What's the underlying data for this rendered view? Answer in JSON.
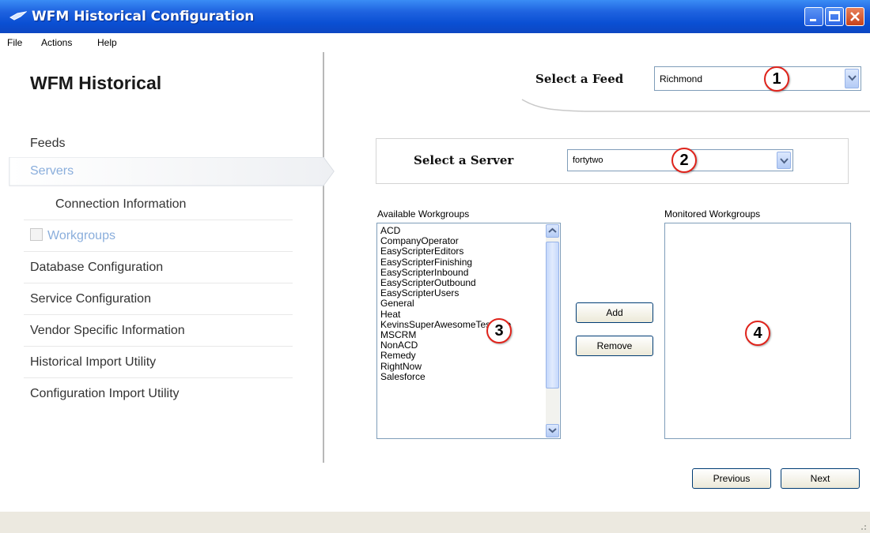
{
  "window": {
    "title": "WFM Historical Configuration"
  },
  "menubar": {
    "items": [
      "File",
      "Actions",
      "Help"
    ]
  },
  "left_panel": {
    "heading": "WFM Historical",
    "nav": [
      {
        "label": "Feeds"
      },
      {
        "label": "Servers",
        "selected": true
      },
      {
        "label": "Connection Information"
      },
      {
        "label": "Workgroups",
        "checkbox": true
      },
      {
        "label": "Database Configuration"
      },
      {
        "label": "Service Configuration"
      },
      {
        "label": "Vendor Specific Information"
      },
      {
        "label": "Historical Import Utility"
      },
      {
        "label": "Configuration Import Utility"
      }
    ]
  },
  "feed": {
    "label": "Select a Feed",
    "value": "Richmond"
  },
  "server": {
    "label": "Select a Server",
    "value": "fortytwo"
  },
  "available": {
    "label": "Available Workgroups",
    "items": [
      "ACD",
      "CompanyOperator",
      "EasyScripterEditors",
      "EasyScripterFinishing",
      "EasyScripterInbound",
      "EasyScripterOutbound",
      "EasyScripterUsers",
      "General",
      "Heat",
      "KevinsSuperAwesomeTestQue",
      "MSCRM",
      "NonACD",
      "Remedy",
      "RightNow",
      "Salesforce"
    ]
  },
  "monitored": {
    "label": "Monitored Workgroups",
    "items": []
  },
  "buttons": {
    "add": "Add",
    "remove": "Remove",
    "previous": "Previous",
    "next": "Next"
  },
  "callouts": [
    "1",
    "2",
    "3",
    "4"
  ],
  "colors": {
    "titlebar": "#0a4fd3",
    "selected_nav_text": "#8aaedc",
    "callout_border": "#e0231b"
  },
  "icons": [
    "app-icon",
    "minimize-icon",
    "maximize-icon",
    "close-icon",
    "dropdown-arrow-icon",
    "scroll-up-icon",
    "scroll-down-icon",
    "resize-grip-icon"
  ]
}
